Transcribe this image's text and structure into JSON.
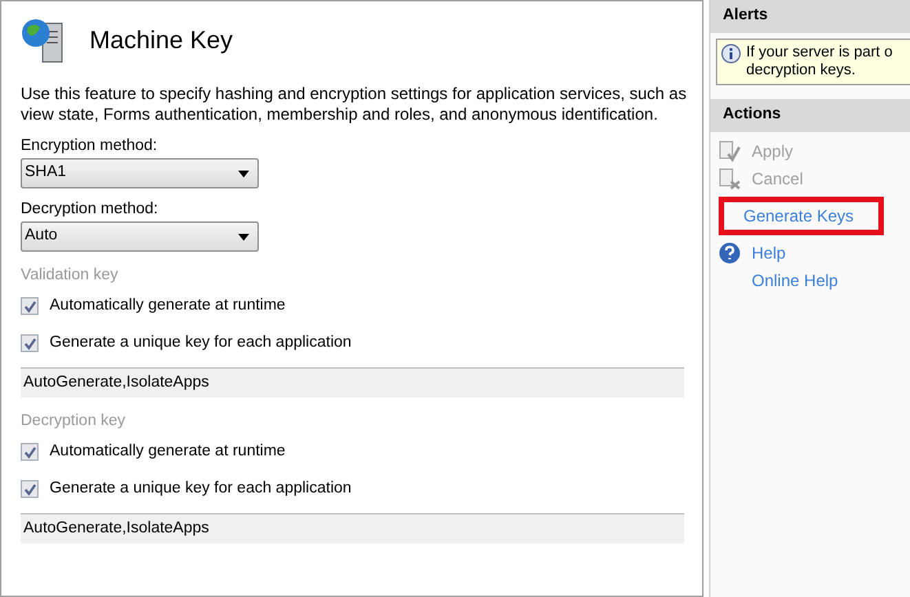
{
  "feature": {
    "title": "Machine Key",
    "description": "Use this feature to specify hashing and encryption settings for application services, such as view state, Forms authentication, membership and roles, and anonymous identification."
  },
  "selects": [
    {
      "label": "Encryption method:",
      "value": "SHA1"
    },
    {
      "label": "Decryption method:",
      "value": "Auto"
    }
  ],
  "key_sections": [
    {
      "title": "Validation key",
      "disabled": true,
      "options": [
        {
          "label": "Automatically generate at runtime",
          "checked": true,
          "disabled": true
        },
        {
          "label": "Generate a unique key for each application",
          "checked": true,
          "disabled": true
        }
      ],
      "value": "AutoGenerate,IsolateApps"
    },
    {
      "title": "Decryption key",
      "disabled": true,
      "options": [
        {
          "label": "Automatically generate at runtime",
          "checked": true,
          "disabled": true
        },
        {
          "label": "Generate a unique key for each application",
          "checked": true,
          "disabled": true
        }
      ],
      "value": "AutoGenerate,IsolateApps"
    }
  ],
  "alerts": {
    "title": "Alerts",
    "message_lines": [
      "If your server is part o",
      "decryption keys."
    ]
  },
  "actions": {
    "title": "Actions",
    "items": [
      {
        "label": "Apply",
        "kind": "apply",
        "disabled": true,
        "highlighted": false
      },
      {
        "label": "Cancel",
        "kind": "cancel",
        "disabled": true,
        "highlighted": false
      },
      {
        "label": "Generate Keys",
        "kind": "plain",
        "disabled": false,
        "highlighted": true
      },
      {
        "label": "Help",
        "kind": "help",
        "disabled": false,
        "highlighted": false
      },
      {
        "label": "Online Help",
        "kind": "plain",
        "disabled": false,
        "highlighted": false
      }
    ]
  }
}
